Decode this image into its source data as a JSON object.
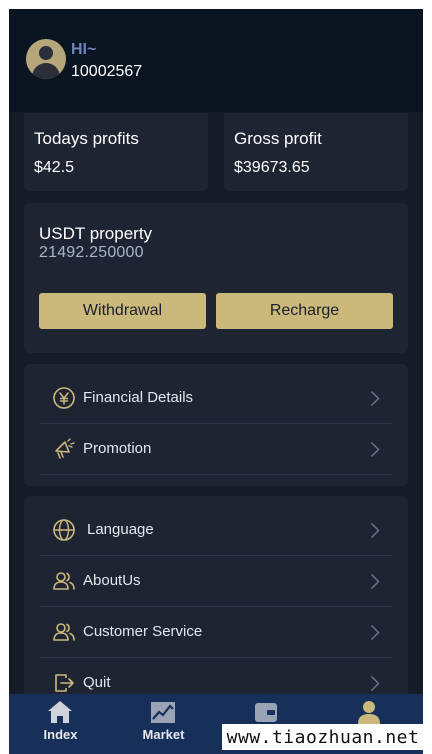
{
  "header": {
    "greeting": "HI~",
    "user_id": "10002567"
  },
  "stats": {
    "todays_profits_label": "Todays profits",
    "todays_profits_value": "$42.5",
    "gross_profit_label": "Gross profit",
    "gross_profit_value": "$39673.65"
  },
  "property": {
    "label": "USDT property",
    "value": "21492.250000",
    "withdrawal_label": "Withdrawal",
    "recharge_label": "Recharge"
  },
  "menu1": [
    {
      "label": "Financial Details",
      "icon": "yen-coin-icon"
    },
    {
      "label": "Promotion",
      "icon": "megaphone-icon"
    }
  ],
  "menu2": [
    {
      "label": "Language",
      "icon": "globe-icon"
    },
    {
      "label": "AboutUs",
      "icon": "users-icon"
    },
    {
      "label": "Customer Service",
      "icon": "users-icon"
    },
    {
      "label": "Quit",
      "icon": "logout-icon"
    }
  ],
  "tabbar": [
    {
      "label": "Index",
      "icon": "home-icon"
    },
    {
      "label": "Market",
      "icon": "chart-icon"
    },
    {
      "label": "",
      "icon": "wallet-icon"
    },
    {
      "label": "",
      "icon": "user-icon"
    }
  ],
  "watermark": "www.tiaozhuan.net",
  "colors": {
    "background": "#161b28",
    "header": "#0b1421",
    "card": "#1f2433",
    "accent_gold": "#cbb97c",
    "tabbar": "#16305a",
    "greeting": "#6f84b8"
  }
}
